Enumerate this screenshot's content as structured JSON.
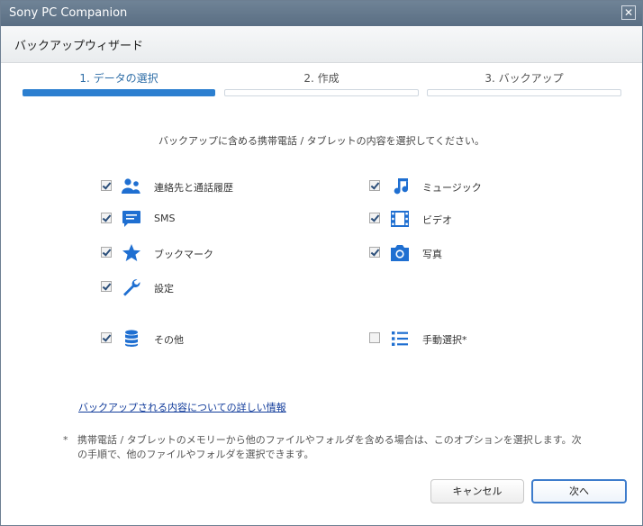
{
  "window": {
    "title": "Sony PC Companion",
    "close_glyph": "✕"
  },
  "wizard": {
    "title": "バックアップウィザード"
  },
  "steps": [
    {
      "label": "1. データの選択",
      "active": true
    },
    {
      "label": "2. 作成",
      "active": false
    },
    {
      "label": "3. バックアップ",
      "active": false
    }
  ],
  "intro": "バックアップに含める携帯電話 / タブレットの内容を選択してください。",
  "items": {
    "contacts": {
      "label": "連絡先と通話履歴",
      "checked": true,
      "icon": "contacts-icon"
    },
    "sms": {
      "label": "SMS",
      "checked": true,
      "icon": "message-icon"
    },
    "bookmarks": {
      "label": "ブックマーク",
      "checked": true,
      "icon": "star-icon"
    },
    "settings": {
      "label": "設定",
      "checked": true,
      "icon": "wrench-icon"
    },
    "other": {
      "label": "その他",
      "checked": true,
      "icon": "database-icon"
    },
    "music": {
      "label": "ミュージック",
      "checked": true,
      "icon": "music-note-icon"
    },
    "video": {
      "label": "ビデオ",
      "checked": true,
      "icon": "film-icon"
    },
    "photos": {
      "label": "写真",
      "checked": true,
      "icon": "camera-icon"
    },
    "manual": {
      "label": "手動選択*",
      "checked": false,
      "icon": "list-icon"
    }
  },
  "details_link": "バックアップされる内容についての詳しい情報",
  "note": {
    "marker": "*",
    "text": "携帯電話 / タブレットのメモリーから他のファイルやフォルダを含める場合は、このオプションを選択します。次の手順で、他のファイルやフォルダを選択できます。"
  },
  "buttons": {
    "cancel": "キャンセル",
    "next": "次へ"
  },
  "colors": {
    "accent": "#2c7fd0",
    "titlebar": "#5f7388",
    "link": "#123c9b"
  }
}
